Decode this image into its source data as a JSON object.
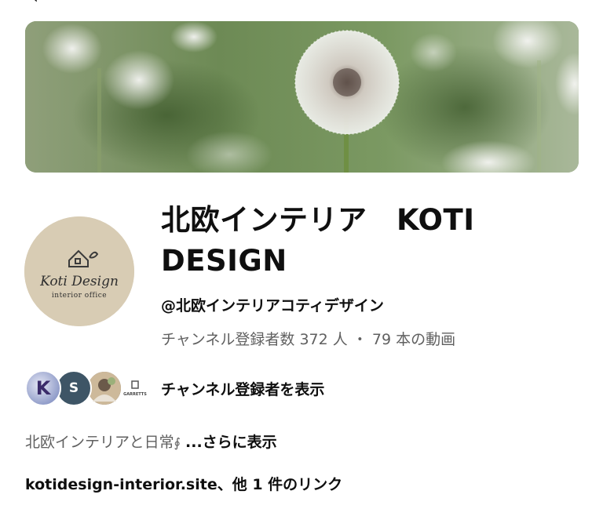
{
  "channel": {
    "title_line1": "北欧インテリア　KOTI",
    "title_line2": "DESIGN",
    "handle": "@北欧インテリアコティデザイン",
    "stats": "チャンネル登録者数 372 人 ・ 79 本の動画",
    "subscribers_label": "チャンネル登録者を表示",
    "description": "北欧インテリアと日常",
    "description_more": "...さらに表示",
    "link_domain": "kotidesign-interior.site",
    "link_suffix": "、他 1 件のリンク"
  },
  "avatar": {
    "logo_text": "Koti Design",
    "logo_sub": "interior office"
  },
  "subscribers": [
    {
      "initial": "K"
    },
    {
      "initial": "S"
    },
    {
      "initial": ""
    },
    {
      "initial": "GARRETTS"
    }
  ],
  "colors": {
    "text_primary": "#0f0f0f",
    "text_secondary": "#606060",
    "avatar_bg": "#d8ccb4"
  },
  "icons": {
    "top": "back-arrow-icon",
    "banner": "dandelion-banner",
    "description_glyph": "integral-icon"
  }
}
